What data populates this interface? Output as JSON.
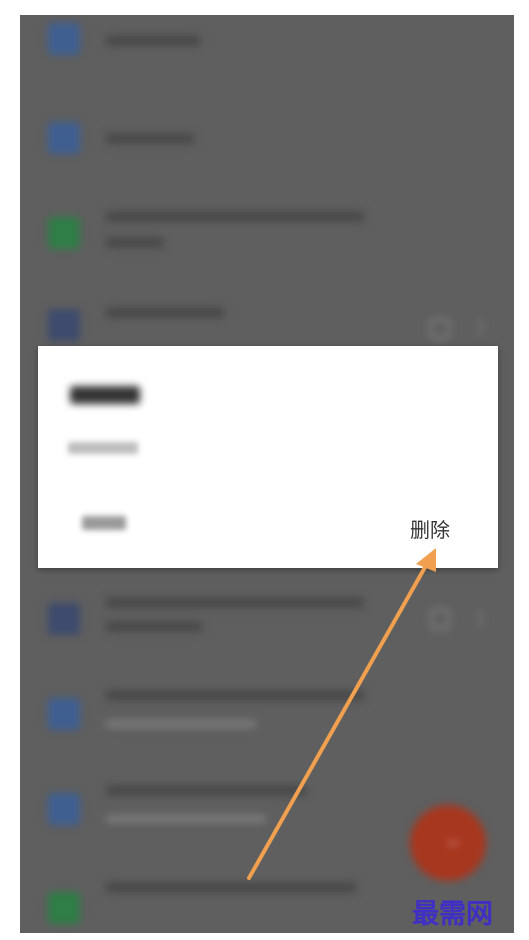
{
  "dialog": {
    "delete_button": "删除"
  },
  "annotation": {
    "arrow_color": "#f0a04e"
  },
  "watermark": {
    "text": "最需网"
  },
  "colors": {
    "blue_icon": "#3f5f91",
    "green_icon": "#2f7d47",
    "indigo_icon": "#3e4b6e",
    "fab": "#a8371f"
  }
}
